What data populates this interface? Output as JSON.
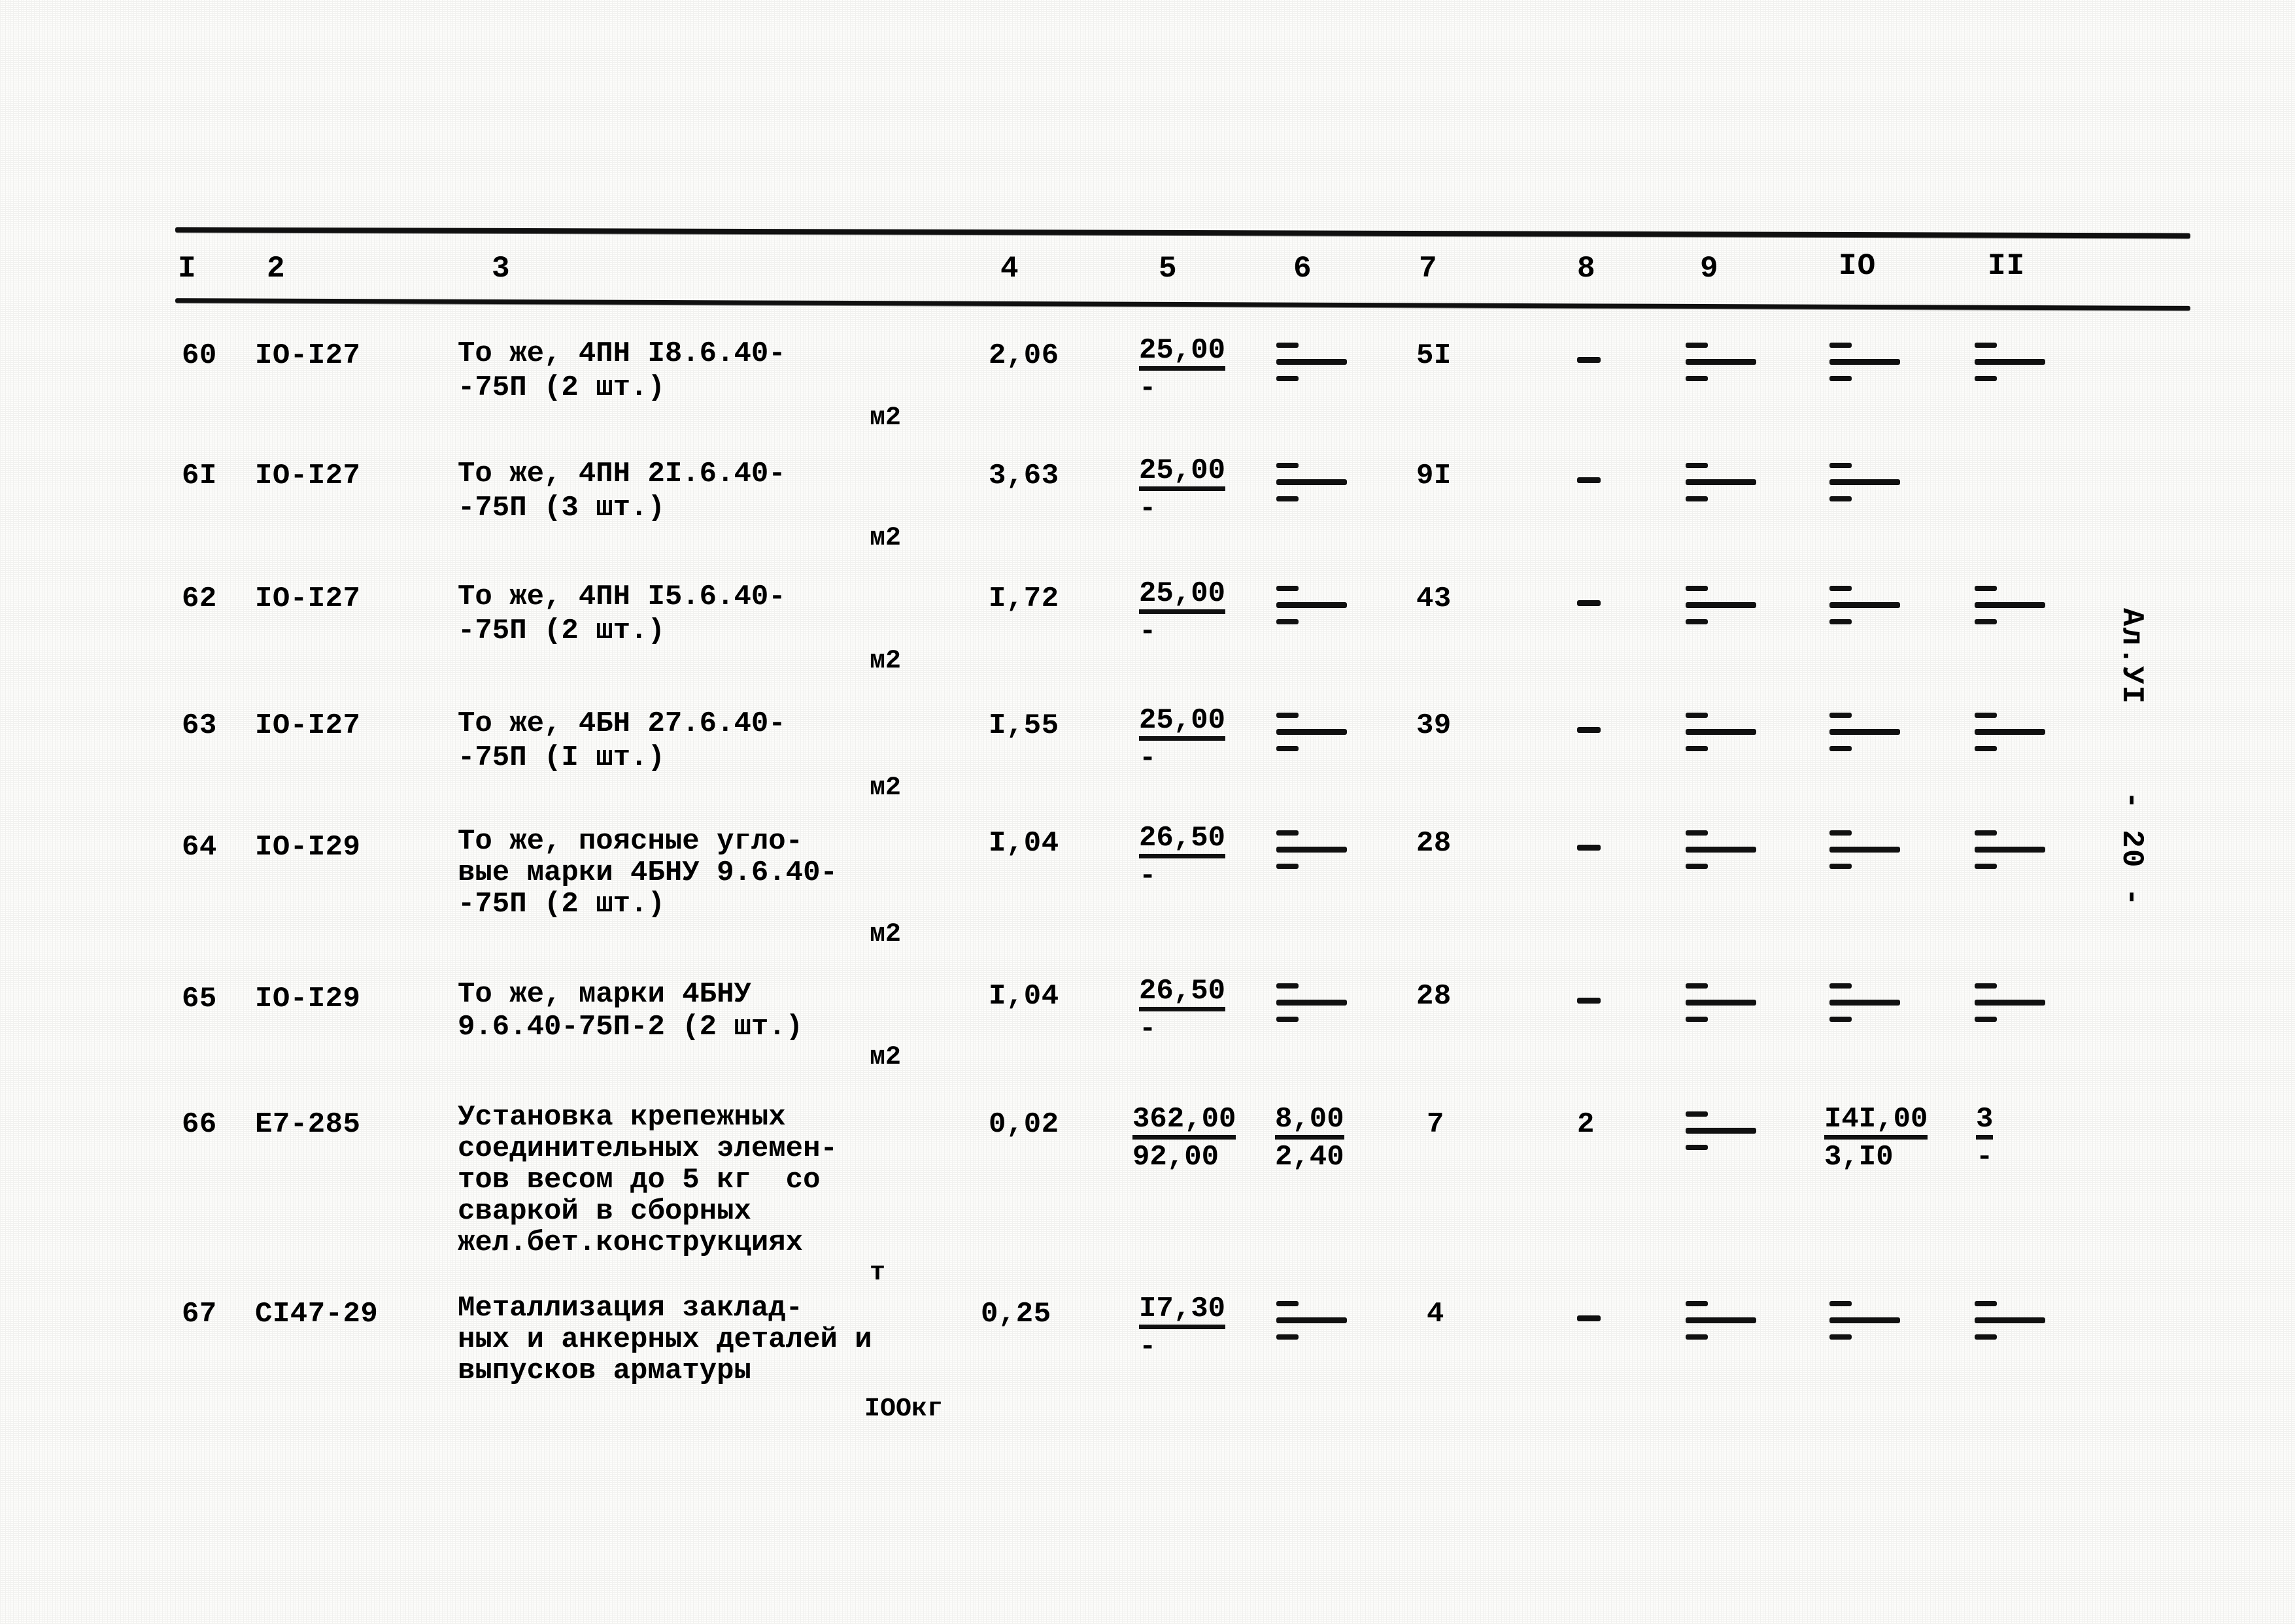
{
  "document": {
    "margin_label": "Ал.УI",
    "page_number_label": "- 20 -"
  },
  "table": {
    "column_headers": [
      "I",
      "2",
      "3",
      "4",
      "5",
      "6",
      "7",
      "8",
      "9",
      "IО",
      "II"
    ],
    "rows": [
      {
        "no": "60",
        "code": "IО-I27",
        "description_lines": [
          "То же, 4ПН I8.6.40-",
          "-75П (2 шт.)"
        ],
        "unit": "м2",
        "c4": "2,06",
        "c5_top": "25,00",
        "c5_bot": "-",
        "c6_top": "-",
        "c6_bot": "-",
        "c7": "5I",
        "c8": "-",
        "c9_top": "-",
        "c9_bot": "-",
        "c10_top": "-",
        "c10_bot": "-",
        "c11_top": "-",
        "c11_bot": "-"
      },
      {
        "no": "6I",
        "code": "IО-I27",
        "description_lines": [
          "То же, 4ПН 2I.6.40-",
          "-75П (3 шт.)"
        ],
        "unit": "м2",
        "c4": "3,63",
        "c5_top": "25,00",
        "c5_bot": "-",
        "c6_top": "-",
        "c6_bot": "-",
        "c7": "9I",
        "c8": "-",
        "c9_top": "-",
        "c9_bot": "-",
        "c10_top": "-",
        "c10_bot": "-",
        "c11_top": "",
        "c11_bot": ""
      },
      {
        "no": "62",
        "code": "IО-I27",
        "description_lines": [
          "То же, 4ПН I5.6.40-",
          "-75П (2 шт.)"
        ],
        "unit": "м2",
        "c4": "I,72",
        "c5_top": "25,00",
        "c5_bot": "-",
        "c6_top": "-",
        "c6_bot": "-",
        "c7": "43",
        "c8": "-",
        "c9_top": "-",
        "c9_bot": "-",
        "c10_top": "-",
        "c10_bot": "-",
        "c11_top": "-",
        "c11_bot": "-"
      },
      {
        "no": "63",
        "code": "IО-I27",
        "description_lines": [
          "То же, 4БН 27.6.40-",
          "-75П (I шт.)"
        ],
        "unit": "м2",
        "c4": "I,55",
        "c5_top": "25,00",
        "c5_bot": "-",
        "c6_top": "-",
        "c6_bot": "-",
        "c7": "39",
        "c8": "-",
        "c9_top": "-",
        "c9_bot": "-",
        "c10_top": "-",
        "c10_bot": "-",
        "c11_top": "-",
        "c11_bot": "-"
      },
      {
        "no": "64",
        "code": "IО-I29",
        "description_lines": [
          "То же, поясные угло-",
          "вые марки 4БНУ 9.6.40-",
          "-75П (2 шт.)"
        ],
        "unit": "м2",
        "c4": "I,04",
        "c5_top": "26,50",
        "c5_bot": "-",
        "c6_top": "-",
        "c6_bot": "-",
        "c7": "28",
        "c8": "-",
        "c9_top": "-",
        "c9_bot": "-",
        "c10_top": "-",
        "c10_bot": "-",
        "c11_top": "-",
        "c11_bot": "-"
      },
      {
        "no": "65",
        "code": "IО-I29",
        "description_lines": [
          "То же, марки 4БНУ",
          "9.6.40-75П-2 (2 шт.)"
        ],
        "unit": "м2",
        "c4": "I,04",
        "c5_top": "26,50",
        "c5_bot": "-",
        "c6_top": "-",
        "c6_bot": "-",
        "c7": "28",
        "c8": "-",
        "c9_top": "-",
        "c9_bot": "-",
        "c10_top": "-",
        "c10_bot": "-",
        "c11_top": "-",
        "c11_bot": "-"
      },
      {
        "no": "66",
        "code": "Е7-285",
        "description_lines": [
          "Установка крепежных",
          "соединительных элемен-",
          "тов весом до 5 кг  со",
          "сваркой в сборных",
          "жел.бет.конструкциях"
        ],
        "unit": "т",
        "c4": "0,02",
        "c5_top": "362,00",
        "c5_bot": "92,00",
        "c6_top": "8,00",
        "c6_bot": "2,40",
        "c7": "7",
        "c8": "2",
        "c9_top": "-",
        "c9_bot": "-",
        "c10_top": "I4I,00",
        "c10_bot": "3,I0",
        "c11_top": "3",
        "c11_bot": "-"
      },
      {
        "no": "67",
        "code": "СI47-29",
        "description_lines": [
          "Металлизация заклад-",
          "ных и анкерных деталей и",
          "выпусков арматуры"
        ],
        "unit": "IООкг",
        "c4": "0,25",
        "c5_top": "I7,30",
        "c5_bot": "-",
        "c6_top": "-",
        "c6_bot": "-",
        "c7": "4",
        "c8": "-",
        "c9_top": "-",
        "c9_bot": "-",
        "c10_top": "-",
        "c10_bot": "-",
        "c11_top": "-",
        "c11_bot": "-"
      }
    ]
  },
  "colors": {
    "ink": "#111111",
    "paper": "#fdfdfb"
  }
}
